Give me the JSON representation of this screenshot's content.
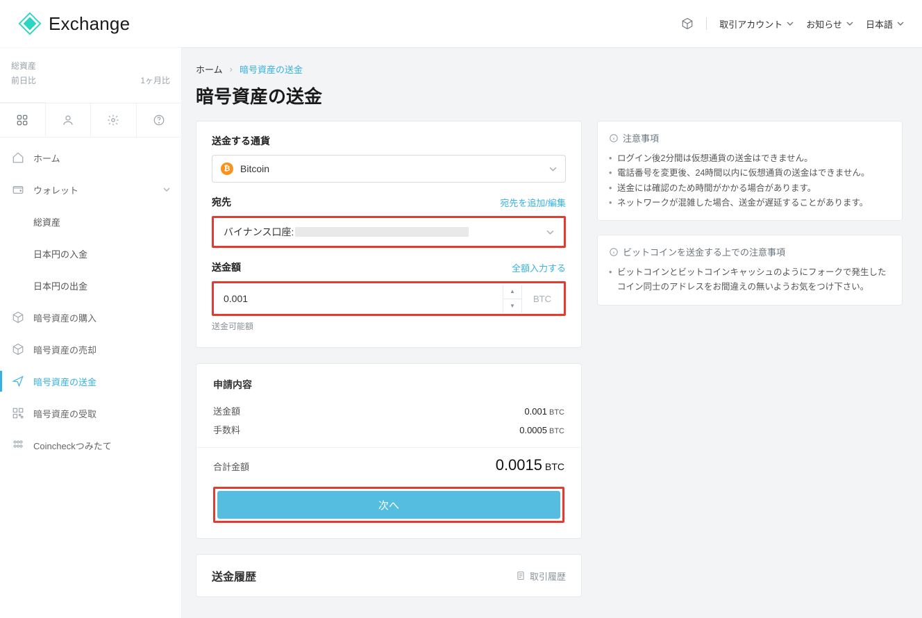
{
  "header": {
    "brand": "Exchange",
    "account_menu": "取引アカウント",
    "notice_menu": "お知らせ",
    "lang_menu": "日本語"
  },
  "sidebar": {
    "balance": {
      "total_label": "総資産",
      "dod_label": "前日比",
      "mom_label": "1ヶ月比"
    },
    "items": {
      "home": "ホーム",
      "wallet": "ウォレット",
      "wallet_children": [
        "総資産",
        "日本円の入金",
        "日本円の出金"
      ],
      "buy": "暗号資産の購入",
      "sell": "暗号資産の売却",
      "send": "暗号資産の送金",
      "receive": "暗号資産の受取",
      "tsumitate": "Coincheckつみたて"
    }
  },
  "breadcrumb": {
    "home": "ホーム",
    "current": "暗号資産の送金"
  },
  "page_title": "暗号資産の送金",
  "form": {
    "currency_label": "送金する通貨",
    "currency_value": "Bitcoin",
    "dest_label": "宛先",
    "dest_edit_link": "宛先を追加/編集",
    "dest_value_prefix": "バイナンス口座:",
    "amount_label": "送金額",
    "amount_fill_link": "全額入力する",
    "amount_value": "0.001",
    "amount_unit": "BTC",
    "amount_hint": "送金可能額"
  },
  "summary": {
    "title": "申請内容",
    "rows": [
      {
        "label": "送金額",
        "value": "0.001",
        "unit": "BTC"
      },
      {
        "label": "手数料",
        "value": "0.0005",
        "unit": "BTC"
      }
    ],
    "total_label": "合計金額",
    "total_value": "0.0015",
    "total_unit": "BTC",
    "next_button": "次へ"
  },
  "notes_general": {
    "title": "注意事項",
    "items": [
      "ログイン後2分間は仮想通貨の送金はできません。",
      "電話番号を変更後、24時間以内に仮想通貨の送金はできません。",
      "送金には確認のため時間がかかる場合があります。",
      "ネットワークが混雑した場合、送金が遅延することがあります。"
    ]
  },
  "notes_btc": {
    "title": "ビットコインを送金する上での注意事項",
    "body": "ビットコインとビットコインキャッシュのようにフォークで発生したコイン同士のアドレスをお間違えの無いようお気をつけ下さい。"
  },
  "history": {
    "title": "送金履歴",
    "link": "取引履歴"
  }
}
